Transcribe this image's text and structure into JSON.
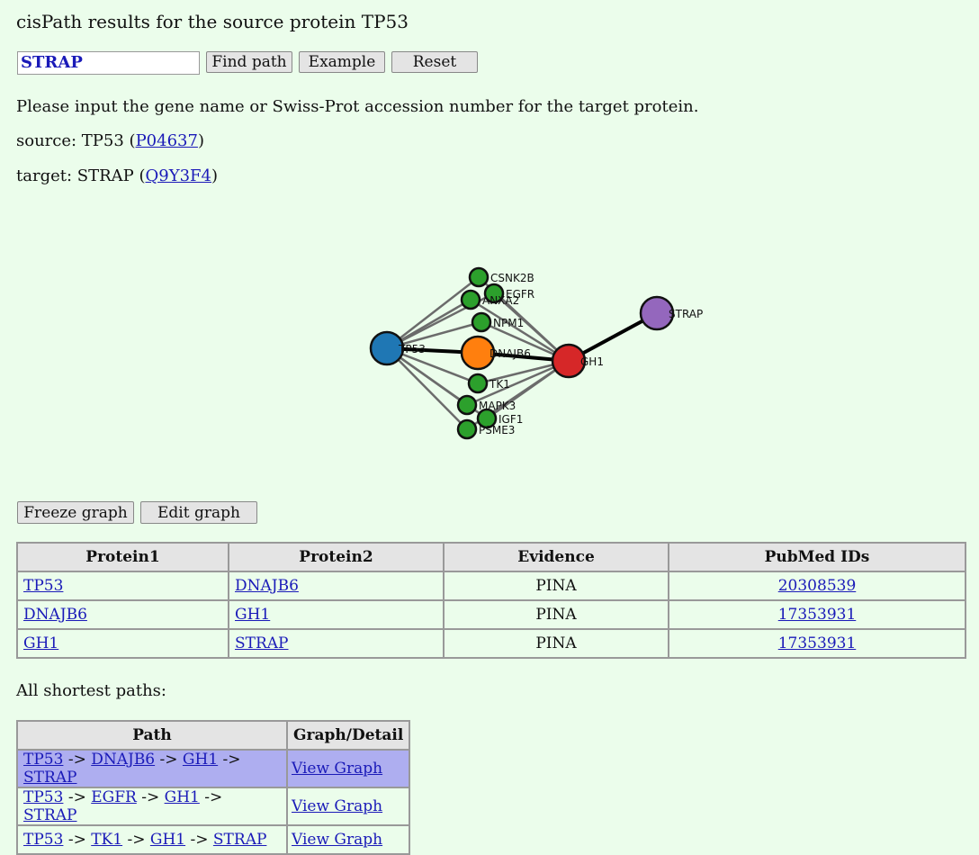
{
  "title": "cisPath results for the source protein TP53",
  "search": {
    "value": "STRAP",
    "find_label": "Find path",
    "example_label": "Example",
    "reset_label": "Reset"
  },
  "instruction": "Please input the gene name or Swiss-Prot accession number for the target protein.",
  "source": {
    "prefix": "source: TP53 (",
    "accession": "P04637",
    "suffix": ")"
  },
  "target": {
    "prefix": "target: STRAP (",
    "accession": "Q9Y3F4",
    "suffix": ")"
  },
  "graph": {
    "nodes": {
      "tp53": {
        "label": "TP53",
        "color": "#1f77b4"
      },
      "dnajb6": {
        "label": "DNAJB6",
        "color": "#ff7f0e"
      },
      "gh1": {
        "label": "GH1",
        "color": "#d62728"
      },
      "strap": {
        "label": "STRAP",
        "color": "#9467bd"
      },
      "csnk2b": {
        "label": "CSNK2B",
        "color": "#2ca02c"
      },
      "egfr": {
        "label": "EGFR",
        "color": "#2ca02c"
      },
      "anxa2": {
        "label": "ANXA2",
        "color": "#2ca02c"
      },
      "npm1": {
        "label": "NPM1",
        "color": "#2ca02c"
      },
      "tk1": {
        "label": "TK1",
        "color": "#2ca02c"
      },
      "mapk3": {
        "label": "MAPK3",
        "color": "#2ca02c"
      },
      "igf1": {
        "label": "IGF1",
        "color": "#2ca02c"
      },
      "psme3": {
        "label": "PSME3",
        "color": "#2ca02c"
      }
    }
  },
  "graph_buttons": {
    "freeze": "Freeze graph",
    "edit": "Edit graph"
  },
  "interactions": {
    "headers": [
      "Protein1",
      "Protein2",
      "Evidence",
      "PubMed IDs"
    ],
    "rows": [
      {
        "p1": "TP53",
        "p2": "DNAJB6",
        "evidence": "PINA",
        "pubmed": "20308539"
      },
      {
        "p1": "DNAJB6",
        "p2": "GH1",
        "evidence": "PINA",
        "pubmed": "17353931"
      },
      {
        "p1": "GH1",
        "p2": "STRAP",
        "evidence": "PINA",
        "pubmed": "17353931"
      }
    ]
  },
  "paths_label": "All shortest paths:",
  "paths": {
    "headers": [
      "Path",
      "Graph/Detail"
    ],
    "arrow": " -> ",
    "view_label": "View Graph",
    "highlight_color": "#aeaef0",
    "rows": [
      [
        "TP53",
        "DNAJB6",
        "GH1",
        "STRAP"
      ],
      [
        "TP53",
        "EGFR",
        "GH1",
        "STRAP"
      ],
      [
        "TP53",
        "TK1",
        "GH1",
        "STRAP"
      ]
    ]
  }
}
